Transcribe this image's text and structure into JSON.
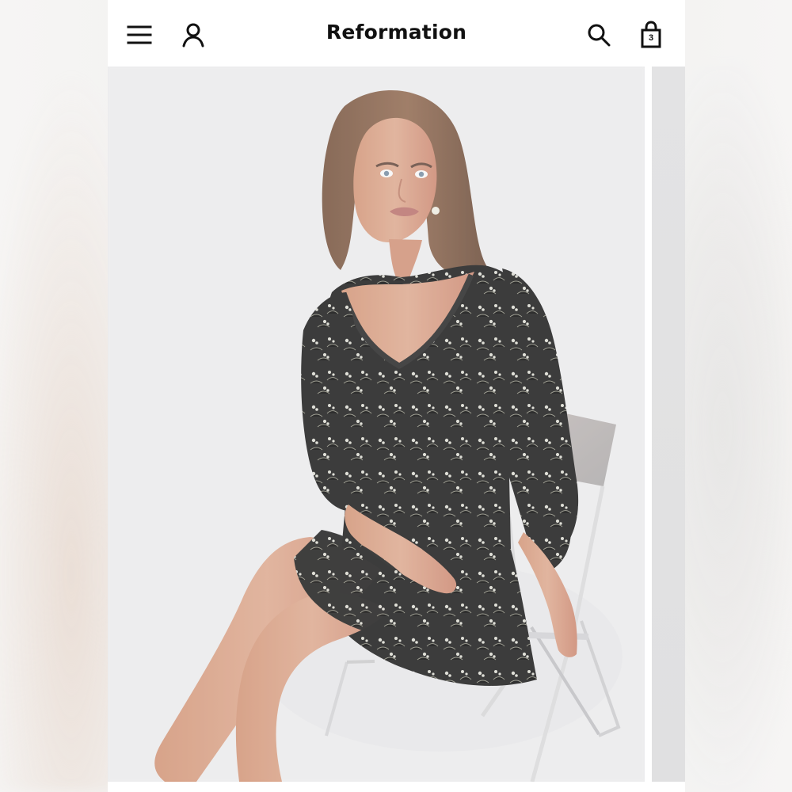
{
  "header": {
    "brand": "Reformation",
    "cart_count": "3",
    "icons": {
      "menu": "hamburger-icon",
      "account": "user-icon",
      "search": "search-icon",
      "cart": "shopping-bag-icon"
    }
  },
  "colors": {
    "header_bg": "#ffffff",
    "text": "#111111",
    "photo_bg": "#e9e9ea"
  }
}
